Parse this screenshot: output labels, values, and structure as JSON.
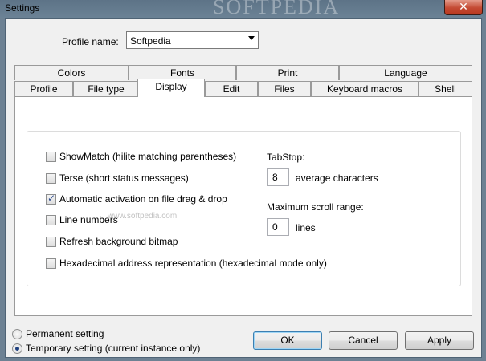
{
  "window": {
    "title": "Settings",
    "watermark": "SOFTPEDIA",
    "close_label": "✕"
  },
  "profile": {
    "label": "Profile name:",
    "value": "Softpedia"
  },
  "tabs_row1": [
    "Colors",
    "Fonts",
    "Print",
    "Language"
  ],
  "tabs_row2": [
    "Profile",
    "File type",
    "Display",
    "Edit",
    "Files",
    "Keyboard macros",
    "Shell"
  ],
  "selected_tab": "Display",
  "display": {
    "options": [
      {
        "label": "ShowMatch (hilite matching parentheses)",
        "checked": false
      },
      {
        "label": "Terse (short status messages)",
        "checked": false
      },
      {
        "label": "Automatic activation on file drag & drop",
        "checked": true
      },
      {
        "label": "Line numbers",
        "checked": false
      },
      {
        "label": "Refresh background bitmap",
        "checked": false
      },
      {
        "label": "Hexadecimal address representation (hexadecimal mode only)",
        "checked": false
      }
    ],
    "tabstop": {
      "label": "TabStop:",
      "value": "8",
      "unit": "average characters"
    },
    "scroll": {
      "label": "Maximum scroll range:",
      "value": "0",
      "unit": "lines"
    },
    "inline_watermark": "www.softpedia.com"
  },
  "setting_scope": {
    "permanent": "Permanent setting",
    "temporary": "Temporary setting (current instance only)",
    "selected": "temporary"
  },
  "buttons": {
    "ok": "OK",
    "cancel": "Cancel",
    "apply": "Apply"
  }
}
